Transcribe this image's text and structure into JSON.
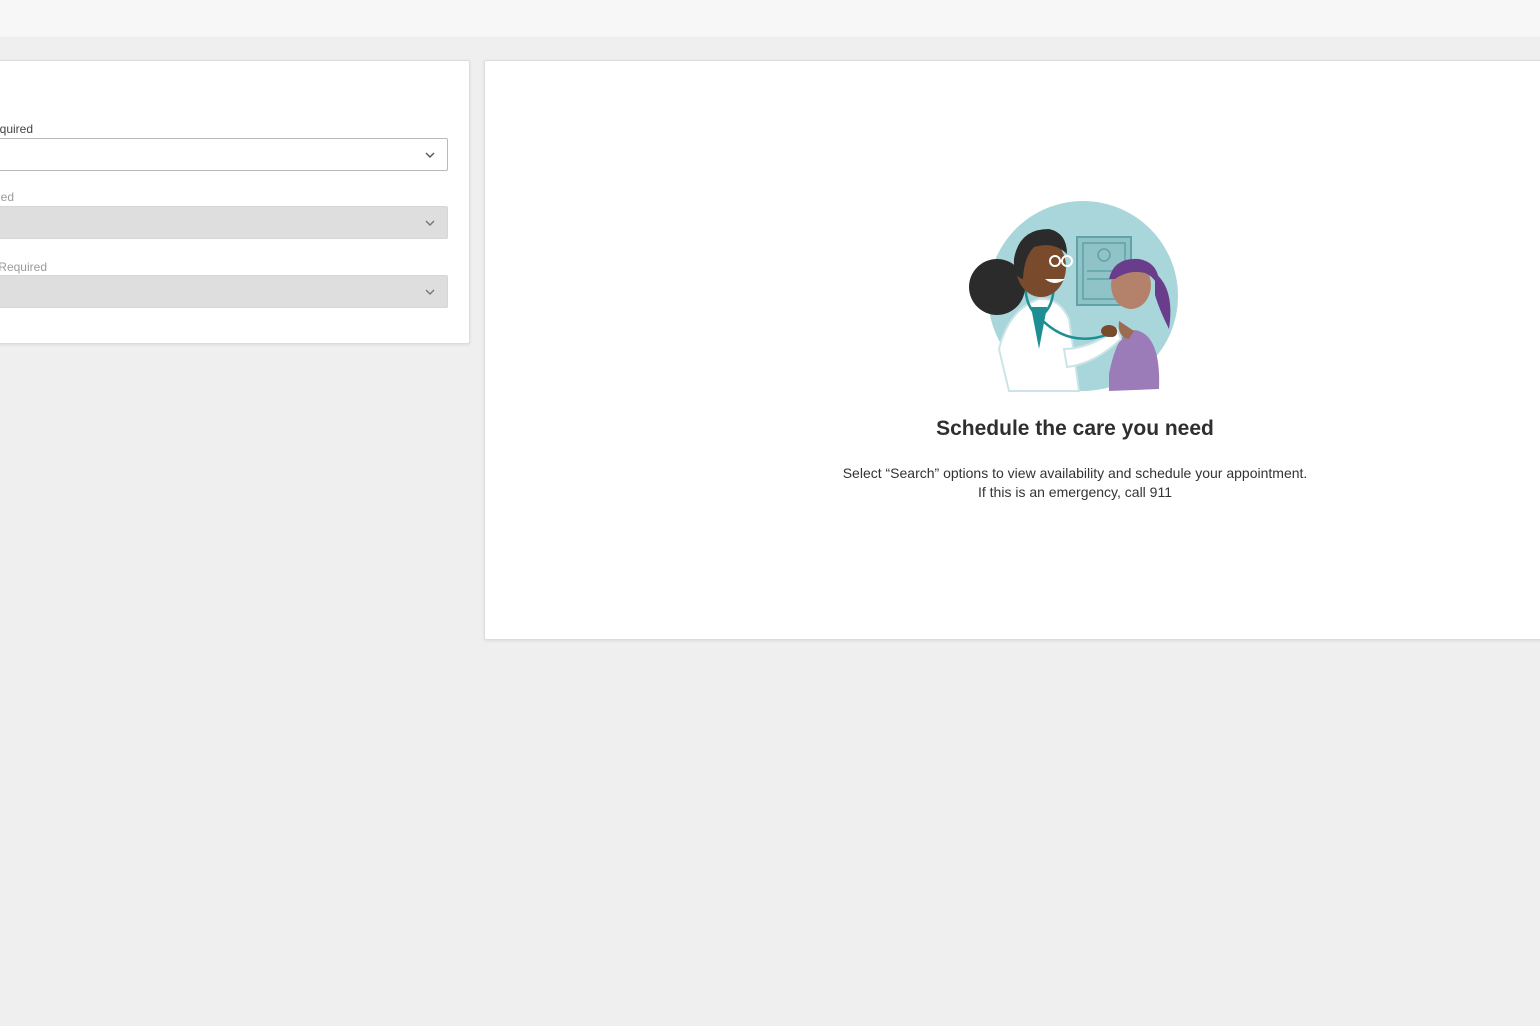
{
  "search_panel": {
    "fields": [
      {
        "label": "Required",
        "visible_label": "quired",
        "state": "enabled",
        "value": ""
      },
      {
        "label": "Required",
        "visible_label": "ed",
        "state": "disabled",
        "value": ""
      },
      {
        "label": "Required",
        "visible_label": "Required",
        "state": "disabled",
        "value": ""
      }
    ]
  },
  "empty_state": {
    "illustration": "doctor-examining-child-illustration",
    "title": "Schedule the care you need",
    "line1": "Select “Search” options to view availability and schedule your appointment.",
    "line2": "If this is an emergency, call 911"
  },
  "colors": {
    "page_bg": "#efefef",
    "card_bg": "#ffffff",
    "disabled_field": "#dedede",
    "illustration_circle": "#a8d6da",
    "accent_purple": "#6a3d8c"
  },
  "icons": {
    "dropdown": "chevron-down-icon"
  }
}
